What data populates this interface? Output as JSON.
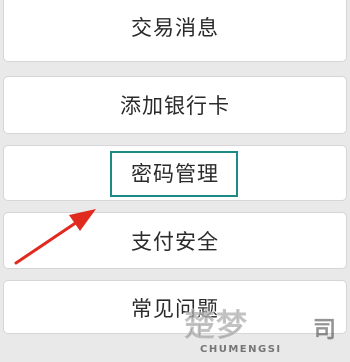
{
  "menu": {
    "items": [
      {
        "label": "交易消息"
      },
      {
        "label": "添加银行卡"
      },
      {
        "label": "密码管理"
      },
      {
        "label": "支付安全"
      },
      {
        "label": "常见问题"
      }
    ]
  },
  "annotation": {
    "highlighted_item": "密码管理",
    "arrow_color": "#e02a1e",
    "highlight_color": "#1c8a86"
  },
  "watermark": {
    "logo_text": "楚梦",
    "seal_text": "司",
    "subtitle": "CHUMENGSI"
  }
}
